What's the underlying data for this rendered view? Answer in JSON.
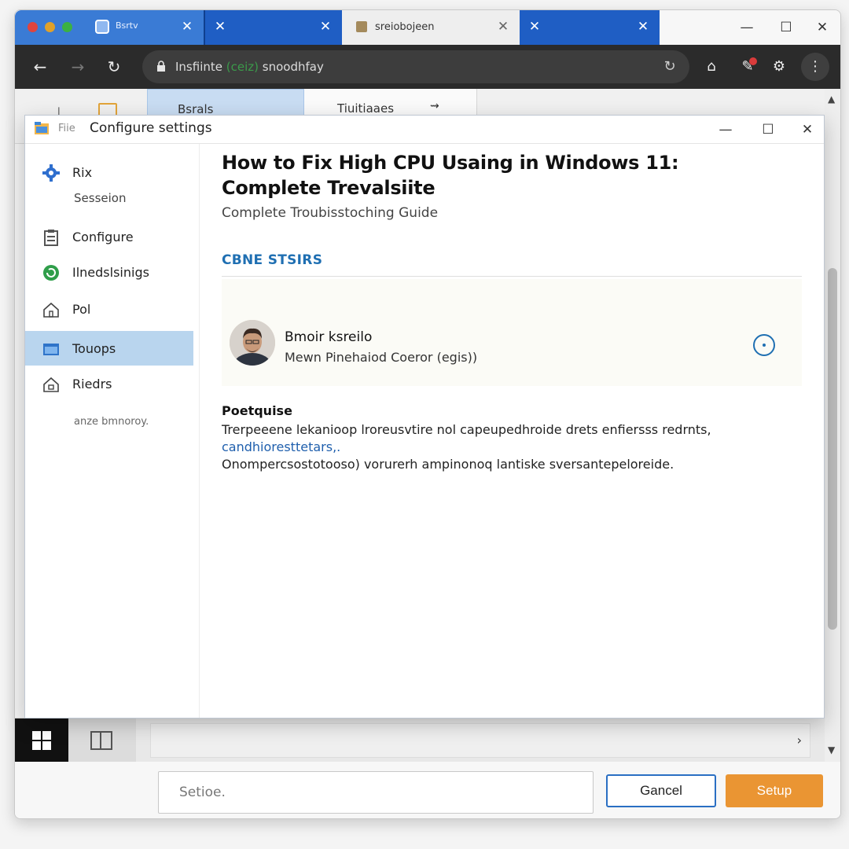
{
  "browser": {
    "tabs": [
      {
        "label": "Bsrtv"
      },
      {
        "label": ""
      },
      {
        "label": "sreiobojeen"
      },
      {
        "label": ""
      }
    ],
    "address": {
      "prefix": "Insfiinte",
      "highlight": "(ceiz)",
      "rest": "snoodhfay"
    }
  },
  "ribbon": {
    "tab_active": "Bsrals",
    "tab_second": "Tiuitiaaes",
    "tab_second_icon": "⇝"
  },
  "dialog": {
    "app_name": "Fiie",
    "title": "Configure settings",
    "sidebar": {
      "items": [
        {
          "label": "Rix",
          "icon": "gear-icon"
        },
        {
          "label": "Configure",
          "icon": "clipboard-icon"
        },
        {
          "label": "Ilnedslsinigs",
          "icon": "refresh-icon"
        },
        {
          "label": "Pol",
          "icon": "home-icon"
        },
        {
          "label": "Touops",
          "icon": "folder-icon"
        },
        {
          "label": "Riedrs",
          "icon": "house-icon"
        }
      ],
      "sub_label": "Sesseion",
      "footer": "anze bmnoroy."
    },
    "article": {
      "title": "How to Fix High CPU Usaing in Windows 11: Complete Trevalsiite",
      "subtitle": "Complete Troubisstoching Guide",
      "section_heading": "CBNE STSIRS",
      "author": {
        "name": "Bmoir ksreilo",
        "role": "Mewn Pinehaiod Coeror (egis))"
      },
      "body_heading": "Poetquise",
      "body_lines": [
        "Trerpeeene lekanioop lroreusvtire nol capeupedhroide drets enfiersss redrnts,",
        "candhioresttetars,.",
        "Onompercsostotooso) vorurerh ampinonoq lantiske sversantepeloreide."
      ]
    }
  },
  "bottom": {
    "input_value": "Setioe.",
    "cancel_label": "Gancel",
    "setup_label": "Setup"
  },
  "colors": {
    "accent": "#1f6fb2",
    "setup_button": "#ea9533",
    "sidebar_active": "#b9d5ee",
    "tab_blue": "#1f5ec4"
  }
}
